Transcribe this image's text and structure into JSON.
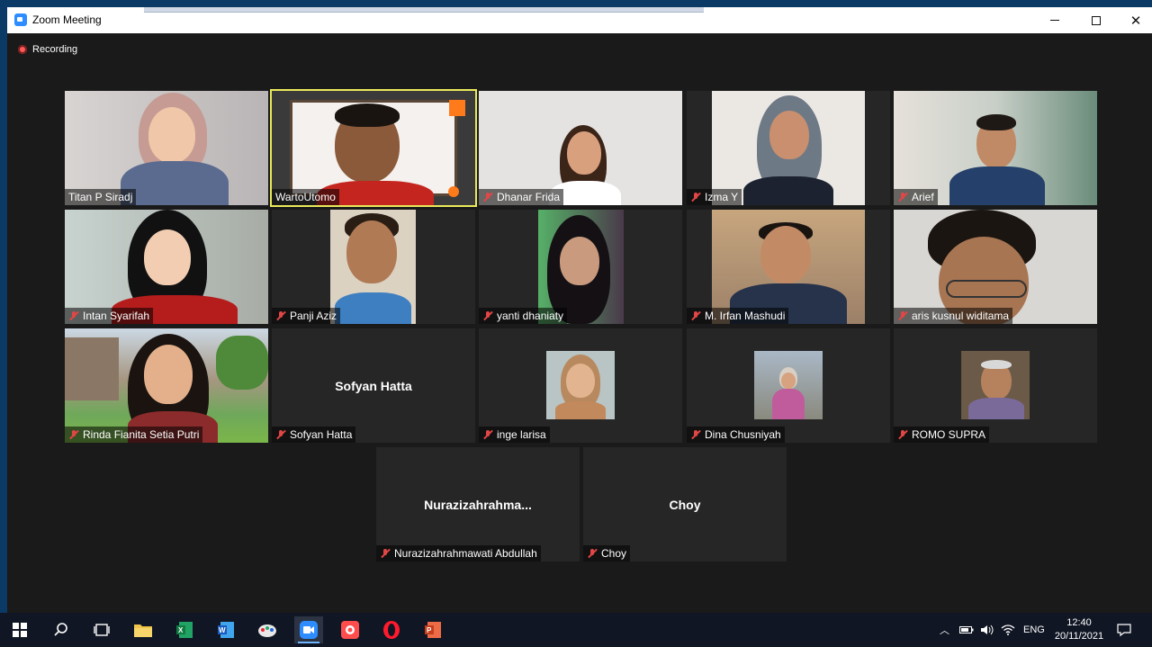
{
  "window": {
    "title": "Zoom Meeting"
  },
  "meeting": {
    "recording_label": "Recording"
  },
  "participants": [
    {
      "name": "Titan P Siradj",
      "muted": false
    },
    {
      "name": "WartoUtomo",
      "muted": false,
      "active_speaker": true
    },
    {
      "name": "Dhanar Frida",
      "muted": true
    },
    {
      "name": "Izma Y",
      "muted": true
    },
    {
      "name": "Arief",
      "muted": true
    },
    {
      "name": "Intan Syarifah",
      "muted": true
    },
    {
      "name": "Panji Aziz",
      "muted": true
    },
    {
      "name": "yanti dhaniaty",
      "muted": true
    },
    {
      "name": "M. Irfan Mashudi",
      "muted": true
    },
    {
      "name": "aris kusnul widitama",
      "muted": true
    },
    {
      "name": "Rinda Fianita Setia Putri",
      "muted": true
    },
    {
      "name": "Sofyan Hatta",
      "muted": true,
      "video_off": true,
      "display_name": "Sofyan Hatta"
    },
    {
      "name": "inge larisa",
      "muted": true
    },
    {
      "name": "Dina Chusniyah",
      "muted": true
    },
    {
      "name": "ROMO SUPRA",
      "muted": true
    },
    {
      "name": "Nurazizahrahmawati Abdullah",
      "muted": true,
      "video_off": true,
      "display_name": "Nurazizahrahma..."
    },
    {
      "name": "Choy",
      "muted": true,
      "video_off": true,
      "display_name": "Choy"
    }
  ],
  "taskbar": {
    "apps": [
      "start-icon",
      "search-icon",
      "task-view-icon",
      "file-explorer-icon",
      "excel-icon",
      "word-icon",
      "paint-icon",
      "zoom-icon",
      "screen-recorder-icon",
      "opera-icon",
      "powerpoint-icon"
    ],
    "language": "ENG",
    "time": "12:40",
    "date": "20/11/2021"
  },
  "colors": {
    "active_speaker_border": "#e9e95a",
    "muted_icon": "#e14646",
    "recording_dot": "#ff5b5b"
  }
}
